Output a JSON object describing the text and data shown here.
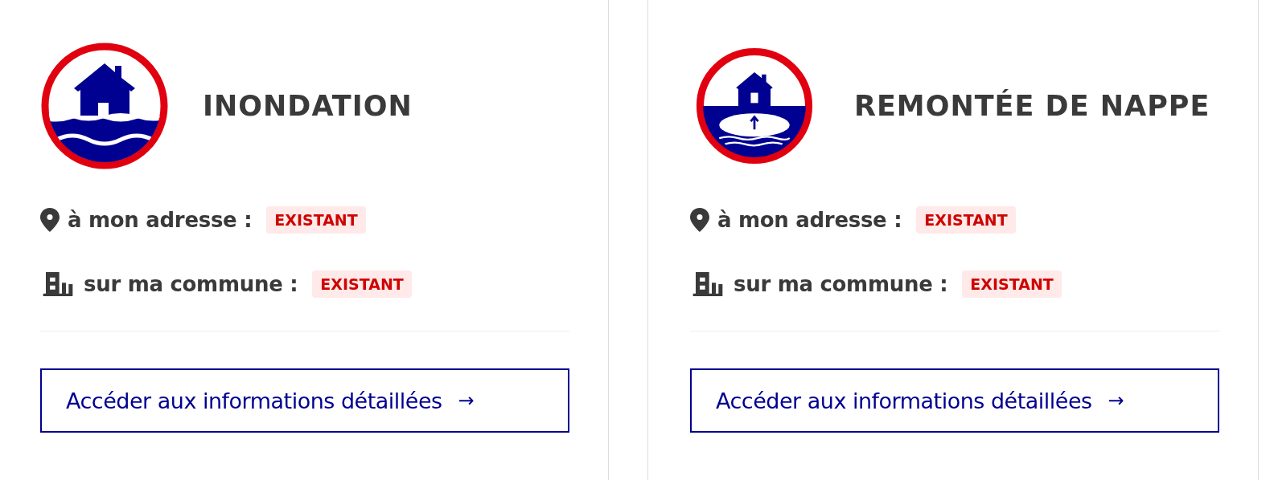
{
  "risks": [
    {
      "kind": "flood",
      "title": "INONDATION",
      "rows": [
        {
          "kind": "address",
          "label": "à mon adresse :",
          "status": "EXISTANT"
        },
        {
          "kind": "commune",
          "label": "sur ma commune :",
          "status": "EXISTANT"
        }
      ],
      "link": "Accéder aux informations détaillées",
      "link_arrow": "→"
    },
    {
      "kind": "groundwater",
      "title": "REMONTÉE DE NAPPE",
      "rows": [
        {
          "kind": "address",
          "label": "à mon adresse :",
          "status": "EXISTANT"
        },
        {
          "kind": "commune",
          "label": "sur ma commune :",
          "status": "EXISTANT"
        }
      ],
      "link": "Accéder aux informations détaillées",
      "link_arrow": "→"
    }
  ]
}
